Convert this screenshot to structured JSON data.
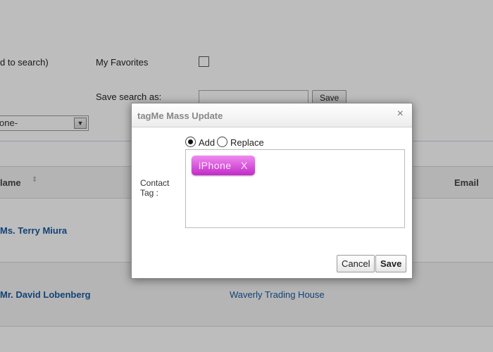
{
  "background": {
    "search_hint": "d to search)",
    "favorites_label": "My Favorites",
    "save_search_label": "Save search as:",
    "save_search_value": "",
    "save_search_button": "Save",
    "select_value": "one-",
    "table": {
      "headers": {
        "name": "lame",
        "email": "Email"
      },
      "rows": [
        {
          "name": "Ms. Terry Miura",
          "company": ""
        },
        {
          "name": "Mr. David Lobenberg",
          "company": "Waverly Trading House"
        }
      ]
    }
  },
  "modal": {
    "title": "tagMe Mass Update",
    "close_glyph": "×",
    "mode_options": [
      {
        "label": "Add",
        "checked": true
      },
      {
        "label": "Replace",
        "checked": false
      }
    ],
    "field_label": "Contact Tag :",
    "tags": [
      {
        "label": "iPhone",
        "remove_glyph": "X"
      }
    ],
    "buttons": {
      "cancel": "Cancel",
      "save": "Save"
    }
  },
  "colors": {
    "link": "#1a5aa0",
    "tag_chip_top": "#f08af0",
    "tag_chip_bottom": "#c22cc8"
  }
}
